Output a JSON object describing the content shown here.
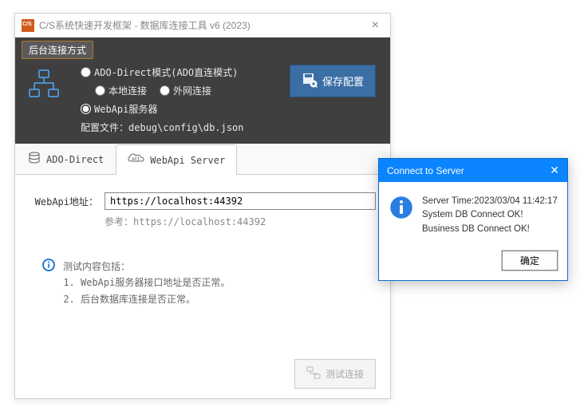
{
  "window": {
    "title": "C/S系统快速开发框架 - 数据库连接工具 v6 (2023)",
    "close_glyph": "×"
  },
  "config": {
    "section_label": "后台连接方式",
    "radio_ado": "ADO-Direct模式(ADO直连模式)",
    "radio_local": "本地连接",
    "radio_external": "外网连接",
    "radio_webapi": "WebApi服务器",
    "file_label": "配置文件：",
    "file_path": "debug\\config\\db.json",
    "save_label": "保存配置"
  },
  "tabs": {
    "ado": "ADO-Direct",
    "webapi": "WebApi Server"
  },
  "form": {
    "addr_label": "WebApi地址：",
    "addr_value": "https://localhost:44392",
    "hint_prefix": "参考：",
    "hint_url": "https://localhost:44392"
  },
  "note": {
    "title": "测试内容包括：",
    "item1": "WebApi服务器接口地址是否正常。",
    "item2": "后台数据库连接是否正常。"
  },
  "footer": {
    "test_label": "测试连接"
  },
  "dialog": {
    "title": "Connect to Server",
    "close_glyph": "✕",
    "line1": "Server Time:2023/03/04 11:42:17",
    "line2": "System DB Connect OK!",
    "line3": "Business DB Connect OK!",
    "ok_label": "确定"
  }
}
